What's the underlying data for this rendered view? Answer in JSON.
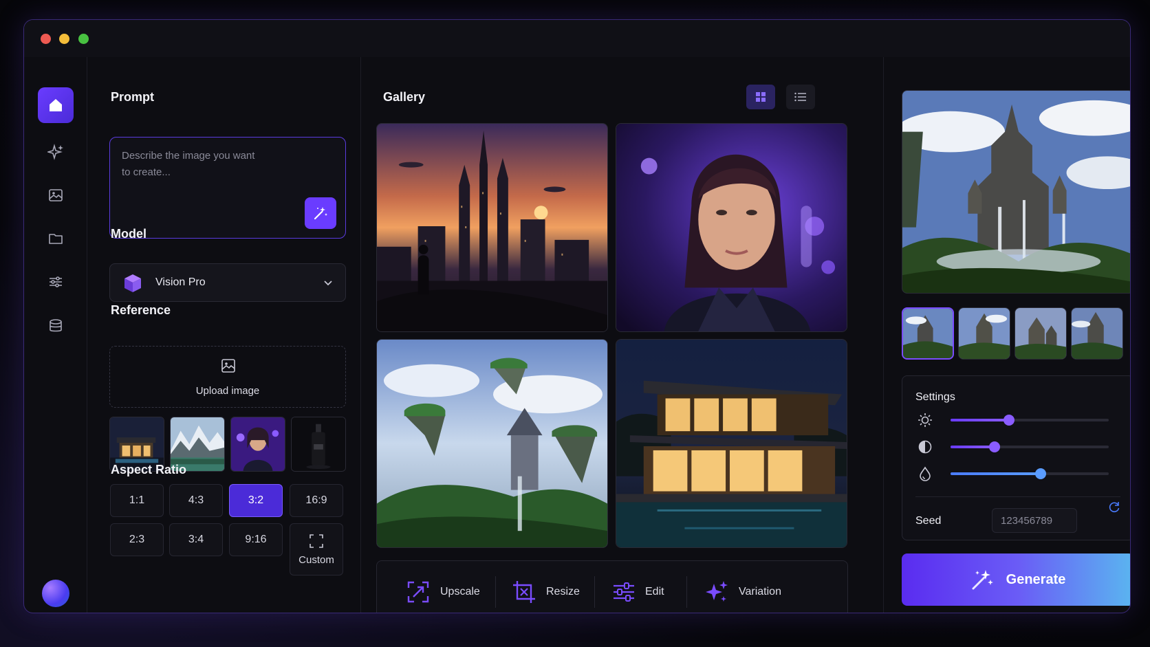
{
  "window": {
    "controls": [
      "close",
      "minimize",
      "maximize"
    ]
  },
  "rail": {
    "items": [
      {
        "icon": "home-icon",
        "active": true
      },
      {
        "icon": "sparkles-icon",
        "active": false
      },
      {
        "icon": "image-icon",
        "active": false
      },
      {
        "icon": "folder-icon",
        "active": false
      },
      {
        "icon": "sliders-icon",
        "active": false
      },
      {
        "icon": "database-icon",
        "active": false
      }
    ],
    "avatar": "avatar"
  },
  "prompt": {
    "heading": "Prompt",
    "placeholder": "Describe the image you want to create..."
  },
  "model": {
    "heading": "Model",
    "selected": "Vision Pro"
  },
  "reference": {
    "heading": "Reference",
    "upload_label": "Upload image",
    "images": [
      "modern-house",
      "mountain-lake",
      "woman-portrait",
      "black-bottle"
    ]
  },
  "aspect": {
    "heading": "Aspect Ratio",
    "options": [
      "1:1",
      "4:3",
      "3:2",
      "16:9",
      "2:3",
      "3:4",
      "9:16",
      "Custom"
    ],
    "selected": "3:2"
  },
  "gallery": {
    "heading": "Gallery",
    "view": "grid",
    "images": [
      "sci-fi-city-sunset",
      "woman-purple-neon",
      "floating-islands-castle",
      "modern-house-night"
    ]
  },
  "toolbar": {
    "upscale": "Upscale",
    "resize": "Resize",
    "edit": "Edit",
    "variation": "Variation"
  },
  "preview": {
    "image": "floating-castle",
    "thumbnails": 4,
    "selected_thumbnail": 0
  },
  "settings": {
    "heading": "Settings",
    "brightness": 0.37,
    "contrast": 0.28,
    "saturation": 0.57,
    "seed_label": "Seed",
    "seed_value": "123456789"
  },
  "generate_label": "Generate",
  "colors": {
    "accent": "#6a3cff",
    "background": "#0d0d12",
    "border": "#3a2a78"
  }
}
